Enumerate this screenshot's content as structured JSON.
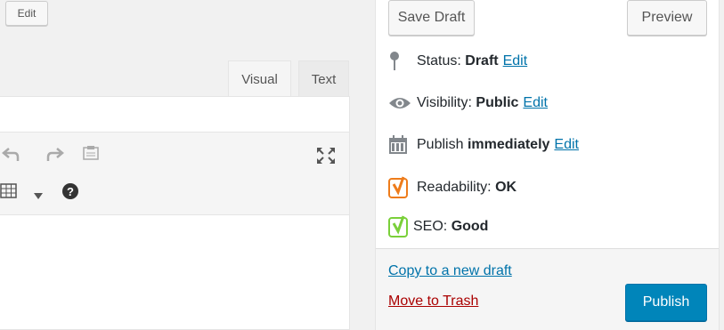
{
  "editor": {
    "edit_label": "Edit",
    "tabs": [
      {
        "label": "Visual"
      },
      {
        "label": "Text"
      }
    ]
  },
  "sidebar": {
    "save_draft_label": "Save Draft",
    "preview_label": "Preview",
    "status": {
      "label": "Status:",
      "value": "Draft",
      "edit": "Edit"
    },
    "visibility": {
      "label": "Visibility:",
      "value": "Public",
      "edit": "Edit"
    },
    "publish_time": {
      "label": "Publish",
      "value": "immediately",
      "edit": "Edit"
    },
    "readability": {
      "label": "Readability:",
      "value": "OK",
      "color": "#ee7c1b"
    },
    "seo": {
      "label": "SEO:",
      "value": "Good",
      "color": "#7ad03a"
    },
    "copy_link": "Copy to a new draft",
    "trash_link": "Move to Trash",
    "publish_label": "Publish"
  },
  "colors": {
    "accent": "#0085ba",
    "link": "#0073aa",
    "danger": "#a00"
  }
}
